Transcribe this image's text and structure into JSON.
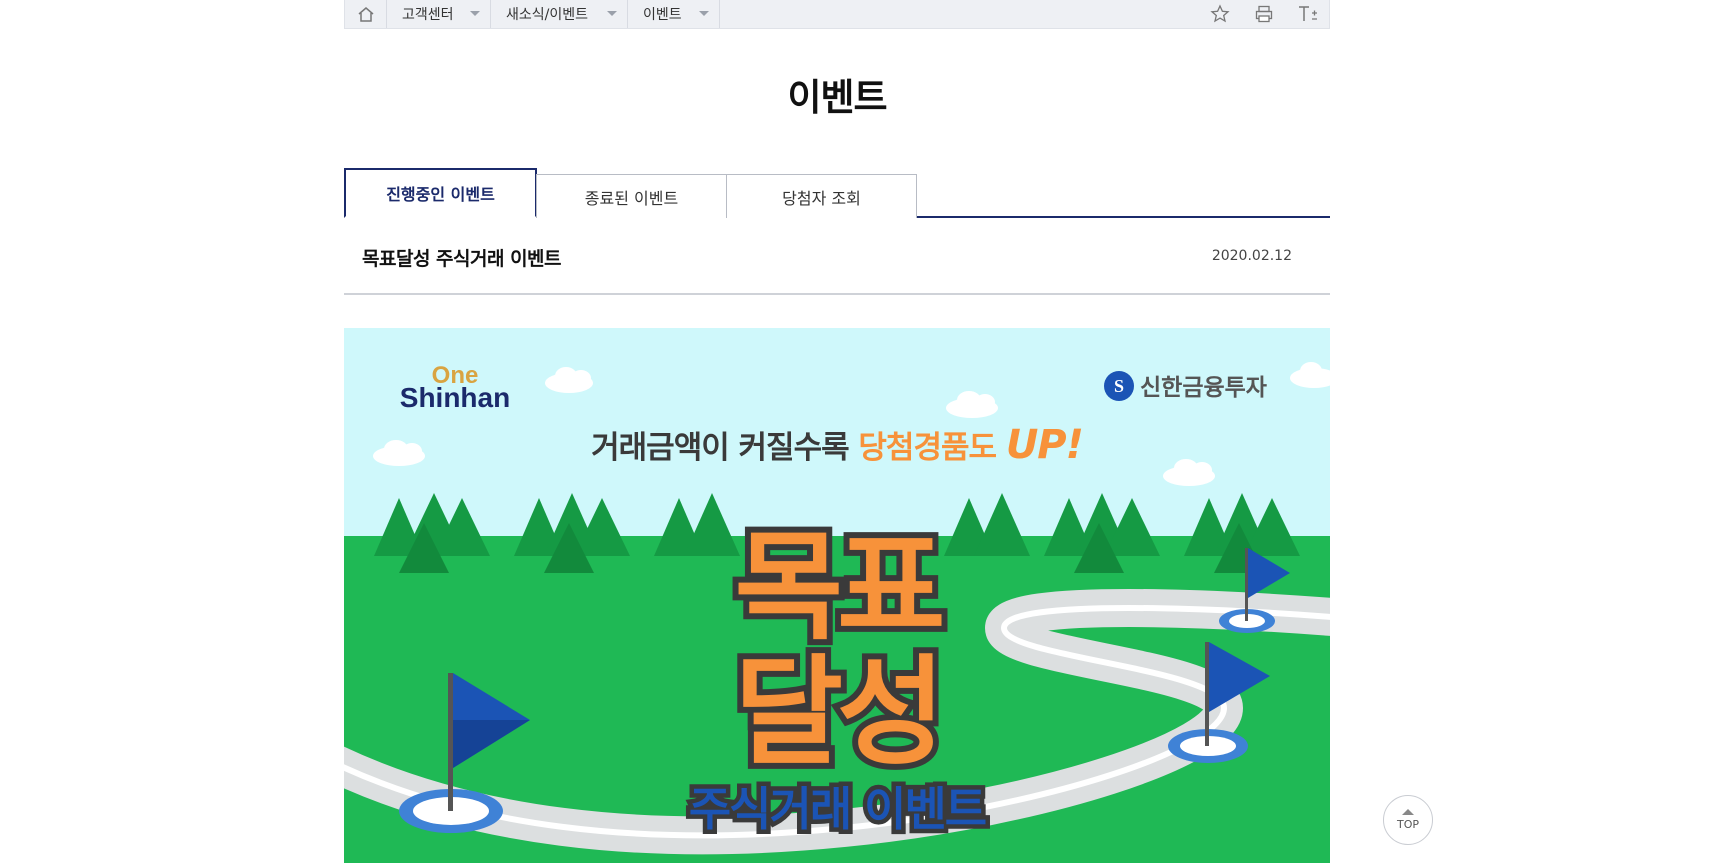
{
  "breadcrumb": {
    "items": [
      {
        "label": "고객센터"
      },
      {
        "label": "새소식/이벤트"
      },
      {
        "label": "이벤트"
      }
    ],
    "tools": [
      "star-icon",
      "print-icon",
      "font-size-icon"
    ]
  },
  "page": {
    "title": "이벤트"
  },
  "tabs": [
    {
      "label": "진행중인 이벤트",
      "active": true
    },
    {
      "label": "종료된 이벤트",
      "active": false
    },
    {
      "label": "당첨자 조회",
      "active": false
    }
  ],
  "post": {
    "title": "목표달성 주식거래 이벤트",
    "date": "2020.02.12"
  },
  "banner": {
    "logo_top": "One",
    "logo_bottom": "Shinhan",
    "brand": "신한금융투자",
    "headline_part1": "거래금액이 커질수록 ",
    "headline_part2": "당첨경품도 ",
    "headline_part3": "UP!",
    "big_line1": "목표",
    "big_line2": "달성",
    "sub": "주식거래 이벤트",
    "colors": {
      "sky": "#cff8fb",
      "grass": "#1fb955",
      "orange": "#f7923a",
      "navy": "#1b2a6b"
    }
  },
  "top_button": {
    "label": "TOP"
  }
}
